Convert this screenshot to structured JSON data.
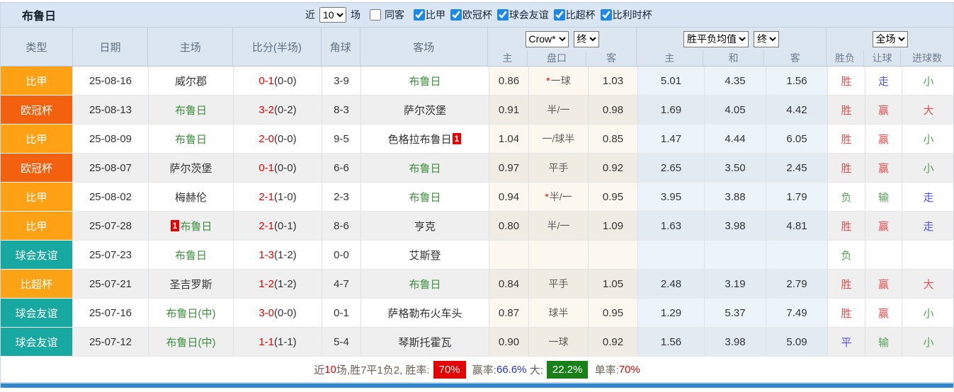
{
  "team_title": "布鲁日",
  "topbar": {
    "recent_label": "近",
    "recent_count": "10",
    "matches_label": "场",
    "same_venue_label": "同客",
    "filters": [
      {
        "label": "比甲",
        "checked": true
      },
      {
        "label": "欧冠杯",
        "checked": true
      },
      {
        "label": "球会友谊",
        "checked": true
      },
      {
        "label": "比超杯",
        "checked": true
      },
      {
        "label": "比利时杯",
        "checked": true
      }
    ]
  },
  "header": {
    "main_cols": [
      "类型",
      "日期",
      "主场",
      "比分(半场)",
      "角球",
      "客场"
    ],
    "odds_source_select": "Crow*",
    "odds_time_select": "终",
    "europe_select": "胜平负均值",
    "europe_time_select": "终",
    "scope_select": "全场",
    "sub_cols": [
      "主",
      "盘口",
      "客",
      "主",
      "和",
      "客",
      "胜负",
      "让球",
      "进球数"
    ]
  },
  "type_colors": {
    "比甲": "#ffa115",
    "欧冠杯": "#f3610e",
    "球会友谊": "#17a8a2",
    "比超杯": "#f9a315"
  },
  "result_colors": {
    "胜": "red",
    "负": "green",
    "平": "blue",
    "赢": "red",
    "输": "green",
    "走": "blue",
    "大": "red",
    "小": "green"
  },
  "rows": [
    {
      "type": "比甲",
      "date": "25-08-16",
      "home": {
        "name": "威尔郡",
        "team": false
      },
      "score": {
        "ft": "0-1",
        "ht": "(0-0)"
      },
      "corners": "3-9",
      "away": {
        "name": "布鲁日",
        "team": true
      },
      "asian": {
        "home": "0.86",
        "star": true,
        "handicap": "一球",
        "away": "1.03"
      },
      "europe": {
        "home": "5.01",
        "draw": "4.35",
        "away": "1.56"
      },
      "outcome": "胜",
      "handicap_result": "走",
      "goals_result": "小"
    },
    {
      "type": "欧冠杯",
      "date": "25-08-13",
      "home": {
        "name": "布鲁日",
        "team": true
      },
      "score": {
        "ft": "3-2",
        "ht": "(0-2)"
      },
      "corners": "8-3",
      "away": {
        "name": "萨尔茨堡",
        "team": false
      },
      "asian": {
        "home": "0.91",
        "star": false,
        "handicap": "半/一",
        "away": "0.98"
      },
      "europe": {
        "home": "1.69",
        "draw": "4.05",
        "away": "4.42"
      },
      "outcome": "胜",
      "handicap_result": "赢",
      "goals_result": "大"
    },
    {
      "type": "比甲",
      "date": "25-08-09",
      "home": {
        "name": "布鲁日",
        "team": true
      },
      "score": {
        "ft": "2-0",
        "ht": "(0-0)"
      },
      "corners": "9-5",
      "away": {
        "name": "色格拉布鲁日",
        "team": false,
        "badge_after": "1"
      },
      "asian": {
        "home": "1.04",
        "star": false,
        "handicap": "一/球半",
        "away": "0.85"
      },
      "europe": {
        "home": "1.47",
        "draw": "4.44",
        "away": "6.05"
      },
      "outcome": "胜",
      "handicap_result": "赢",
      "goals_result": "小"
    },
    {
      "type": "欧冠杯",
      "date": "25-08-07",
      "home": {
        "name": "萨尔茨堡",
        "team": false
      },
      "score": {
        "ft": "0-1",
        "ht": "(0-0)"
      },
      "corners": "6-6",
      "away": {
        "name": "布鲁日",
        "team": true
      },
      "asian": {
        "home": "0.97",
        "star": false,
        "handicap": "平手",
        "away": "0.92"
      },
      "europe": {
        "home": "2.65",
        "draw": "3.50",
        "away": "2.45"
      },
      "outcome": "胜",
      "handicap_result": "赢",
      "goals_result": "小"
    },
    {
      "type": "比甲",
      "date": "25-08-02",
      "home": {
        "name": "梅赫伦",
        "team": false
      },
      "score": {
        "ft": "2-1",
        "ht": "(1-0)"
      },
      "corners": "2-3",
      "away": {
        "name": "布鲁日",
        "team": true
      },
      "asian": {
        "home": "0.94",
        "star": true,
        "handicap": "半/一",
        "away": "0.95"
      },
      "europe": {
        "home": "3.95",
        "draw": "3.88",
        "away": "1.79"
      },
      "outcome": "负",
      "handicap_result": "输",
      "goals_result": "走"
    },
    {
      "type": "比甲",
      "date": "25-07-28",
      "home": {
        "name": "布鲁日",
        "team": true,
        "badge_before": "1"
      },
      "score": {
        "ft": "2-1",
        "ht": "(0-1)"
      },
      "corners": "8-6",
      "away": {
        "name": "亨克",
        "team": false
      },
      "asian": {
        "home": "0.80",
        "star": false,
        "handicap": "半/一",
        "away": "1.09"
      },
      "europe": {
        "home": "1.63",
        "draw": "3.98",
        "away": "4.81"
      },
      "outcome": "胜",
      "handicap_result": "赢",
      "goals_result": "走"
    },
    {
      "type": "球会友谊",
      "date": "25-07-23",
      "home": {
        "name": "布鲁日",
        "team": true
      },
      "score": {
        "ft": "1-3",
        "ht": "(1-2)"
      },
      "corners": "0-0",
      "away": {
        "name": "艾斯登",
        "team": false
      },
      "asian": {
        "home": "",
        "star": false,
        "handicap": "",
        "away": ""
      },
      "europe": {
        "home": "",
        "draw": "",
        "away": ""
      },
      "outcome": "负",
      "handicap_result": "",
      "goals_result": ""
    },
    {
      "type": "比超杯",
      "date": "25-07-21",
      "home": {
        "name": "圣吉罗斯",
        "team": false
      },
      "score": {
        "ft": "1-2",
        "ht": "(1-2)"
      },
      "corners": "4-7",
      "away": {
        "name": "布鲁日",
        "team": true
      },
      "asian": {
        "home": "0.84",
        "star": false,
        "handicap": "平手",
        "away": "1.05"
      },
      "europe": {
        "home": "2.48",
        "draw": "3.19",
        "away": "2.79"
      },
      "outcome": "胜",
      "handicap_result": "赢",
      "goals_result": "大"
    },
    {
      "type": "球会友谊",
      "date": "25-07-16",
      "home": {
        "name": "布鲁日(中)",
        "team": true
      },
      "score": {
        "ft": "3-0",
        "ht": "(0-0)"
      },
      "corners": "0-1",
      "away": {
        "name": "萨格勒布火车头",
        "team": false
      },
      "asian": {
        "home": "0.87",
        "star": false,
        "handicap": "球半",
        "away": "0.95"
      },
      "europe": {
        "home": "1.29",
        "draw": "5.37",
        "away": "7.49"
      },
      "outcome": "胜",
      "handicap_result": "赢",
      "goals_result": "小"
    },
    {
      "type": "球会友谊",
      "date": "25-07-12",
      "home": {
        "name": "布鲁日(中)",
        "team": true
      },
      "score": {
        "ft": "1-1",
        "ht": "(1-1)"
      },
      "corners": "5-4",
      "away": {
        "name": "琴斯托霍瓦",
        "team": false
      },
      "asian": {
        "home": "0.90",
        "star": false,
        "handicap": "一球",
        "away": "0.92"
      },
      "europe": {
        "home": "1.56",
        "draw": "3.98",
        "away": "5.09"
      },
      "outcome": "平",
      "handicap_result": "输",
      "goals_result": "小"
    }
  ],
  "footer": {
    "prefix": "近",
    "count": "10",
    "mid": "场,胜7平1负2, 胜率:",
    "win_rate": "70%",
    "win_odds_label": " 赢率:",
    "win_odds_rate": "66.6%",
    "big_label": " 大:",
    "big_rate": "22.2%",
    "single_label": " 单率:",
    "single_rate": "70%"
  }
}
